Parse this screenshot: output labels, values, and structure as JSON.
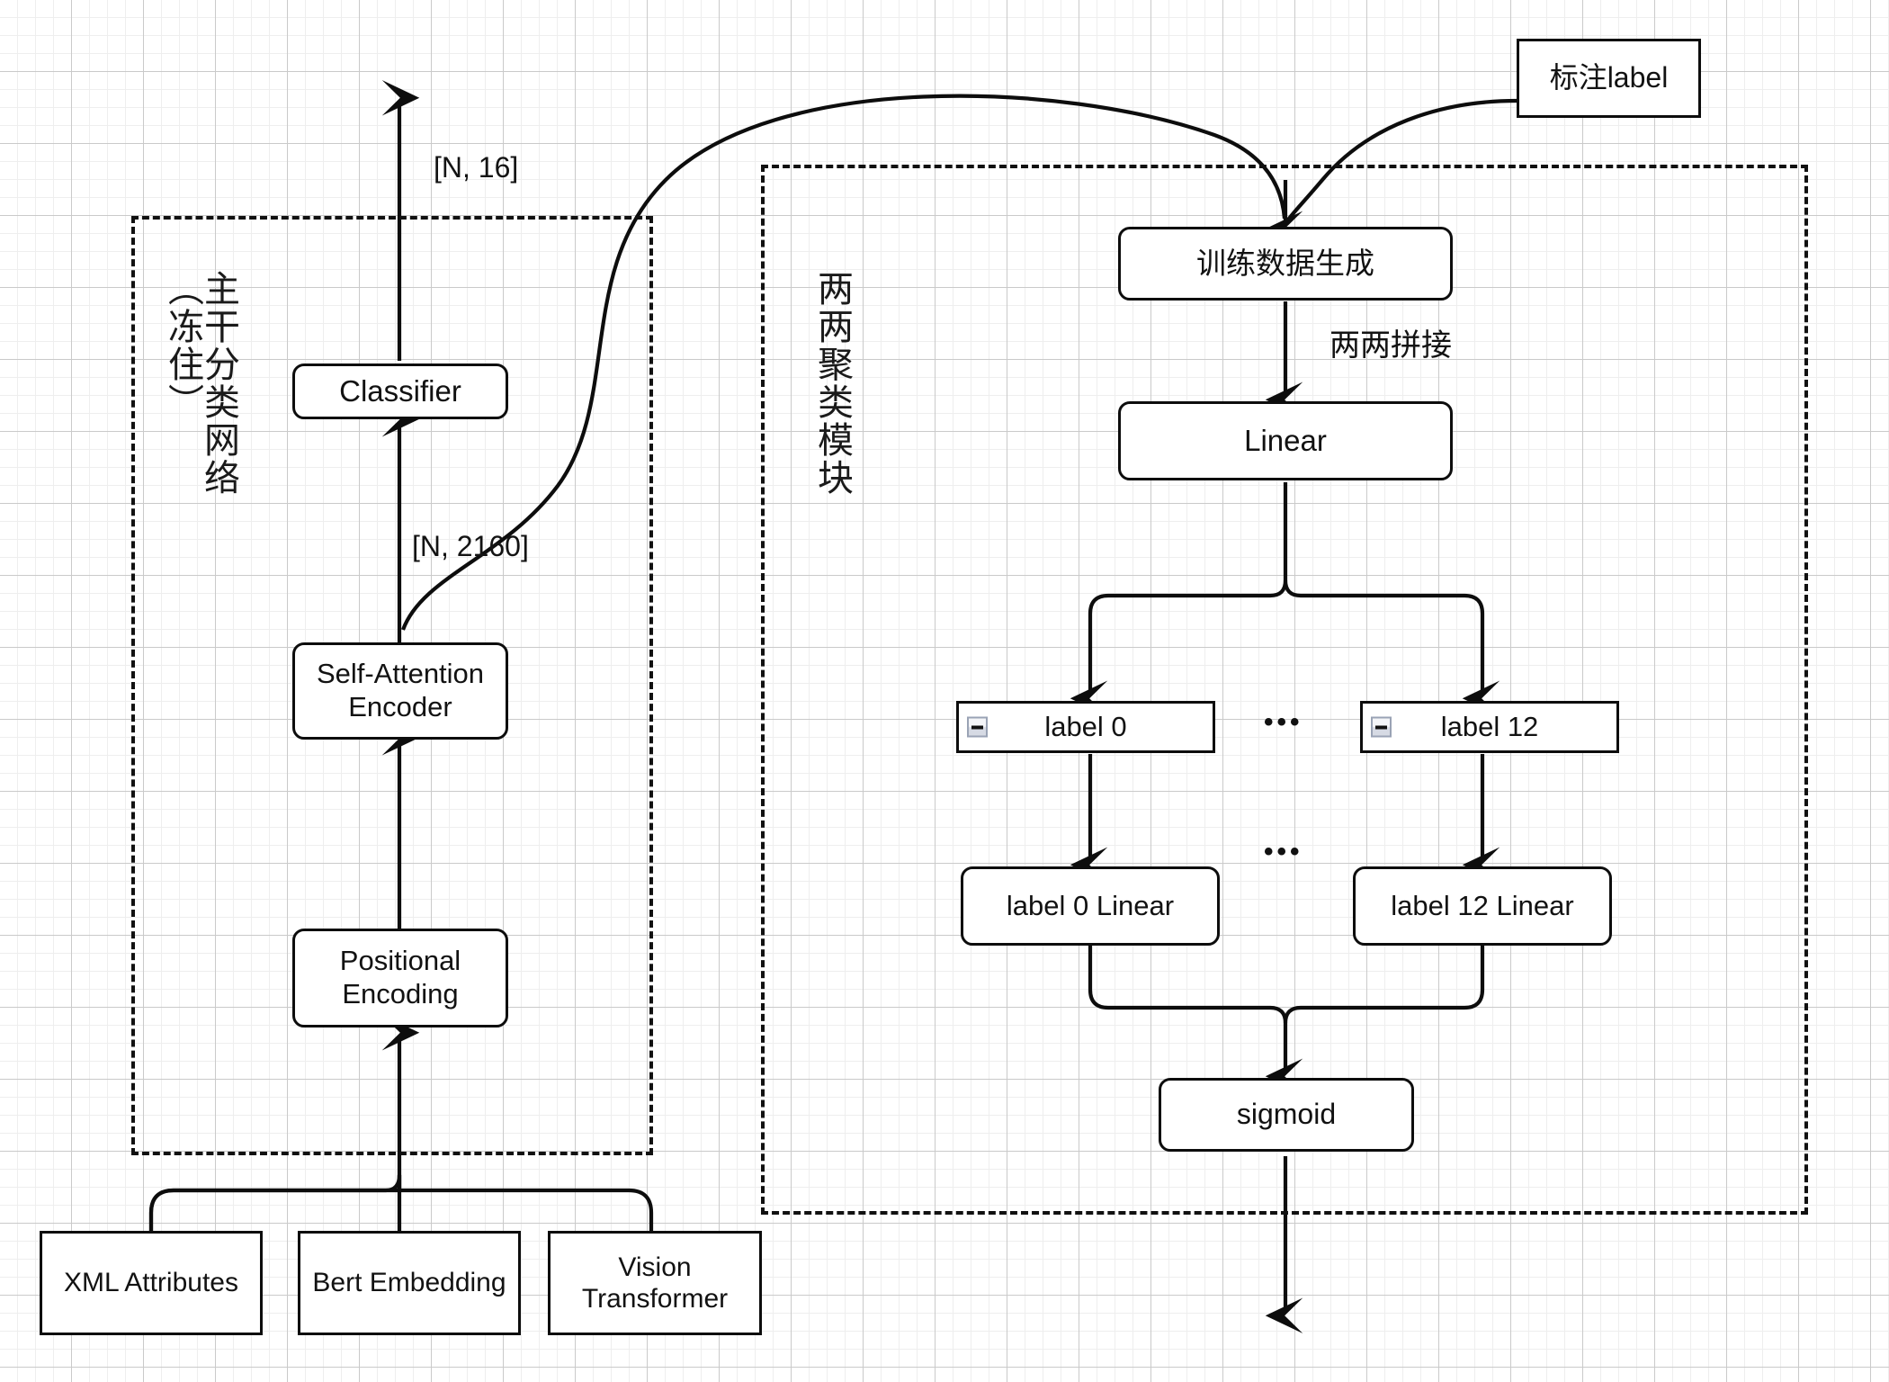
{
  "diagram": {
    "title_text_present": false,
    "groups": [
      {
        "id": "backbone",
        "label": "主干分类网络\n（冻住）",
        "label_plain": "主干分类网络（冻住）"
      },
      {
        "id": "pairwise",
        "label": "两两聚类模块",
        "label_plain": "两两聚类模块"
      }
    ],
    "nodes": [
      {
        "id": "classifier",
        "label": "Classifier"
      },
      {
        "id": "self-attention",
        "label": "Self-Attention\nEncoder"
      },
      {
        "id": "positional",
        "label": "Positional\nEncoding"
      },
      {
        "id": "xml-attributes",
        "label": "XML Attributes"
      },
      {
        "id": "bert-embedding",
        "label": "Bert Embedding"
      },
      {
        "id": "vision-transformer",
        "label": "Vision\nTransformer"
      },
      {
        "id": "annotation-label",
        "label": "标注label"
      },
      {
        "id": "train-data-gen",
        "label": "训练数据生成"
      },
      {
        "id": "linear",
        "label": "Linear"
      },
      {
        "id": "label-0",
        "label": "label 0"
      },
      {
        "id": "label-12",
        "label": "label 12"
      },
      {
        "id": "label-0-linear",
        "label": "label 0 Linear"
      },
      {
        "id": "label-12-linear",
        "label": "label 12 Linear"
      },
      {
        "id": "sigmoid",
        "label": "sigmoid"
      }
    ],
    "edge_labels": [
      {
        "id": "n16",
        "text": "[N, 16]"
      },
      {
        "id": "n2160",
        "text": "[N, 2160]"
      },
      {
        "id": "concat",
        "text": "两两拼接"
      }
    ],
    "ellipses": [
      {
        "id": "ellipsis-labels",
        "text": "•••"
      },
      {
        "id": "ellipsis-linears",
        "text": "•••"
      }
    ],
    "icons": [
      {
        "id": "collapse-label-0",
        "name": "collapse-minus-icon"
      },
      {
        "id": "collapse-label-12",
        "name": "collapse-minus-icon"
      }
    ],
    "colors": {
      "stroke": "#0d0d0d",
      "node_fill": "#ffffff",
      "canvas": "#ffffff",
      "grid_minor": "#eeeeee",
      "grid_major": "#cacaca",
      "dashed_frame": "#111111",
      "collapse_icon_border": "#9aa3b5"
    }
  }
}
